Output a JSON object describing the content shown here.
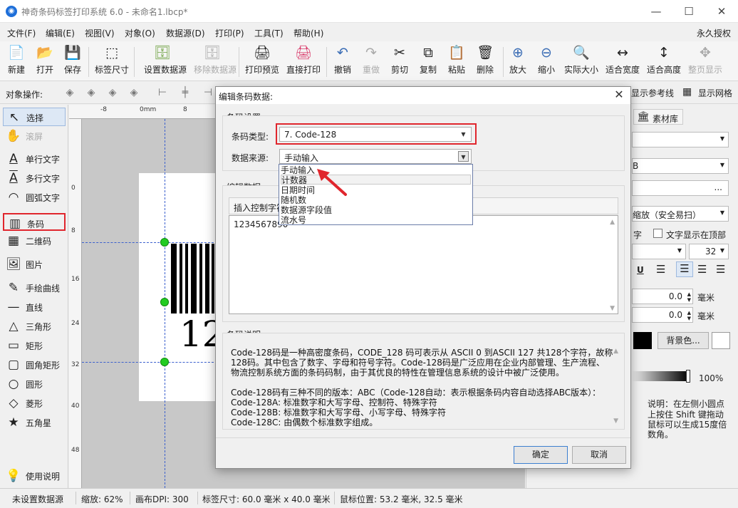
{
  "window": {
    "title": "神奇条码标签打印系统 6.0 - 未命名1.lbcp*",
    "minimize": "—",
    "maximize": "☐",
    "close": "✕"
  },
  "menu": [
    "文件(F)",
    "编辑(E)",
    "视图(V)",
    "对象(O)",
    "数据源(D)",
    "打印(P)",
    "工具(T)",
    "帮助(H)"
  ],
  "menu_right": "永久授权",
  "toolbar": [
    {
      "label": "新建",
      "icon": "📄"
    },
    {
      "label": "打开",
      "icon": "📂"
    },
    {
      "label": "保存",
      "icon": "💾"
    },
    {
      "label": "标签尺寸",
      "icon": "⬚"
    },
    {
      "label": "设置数据源",
      "icon": "🗄"
    },
    {
      "label": "移除数据源",
      "icon": "🗄"
    },
    {
      "label": "打印预览",
      "icon": "🖨"
    },
    {
      "label": "直接打印",
      "icon": "🖨"
    },
    {
      "label": "撤销",
      "icon": "↶"
    },
    {
      "label": "重做",
      "icon": "↷"
    },
    {
      "label": "剪切",
      "icon": "✂"
    },
    {
      "label": "复制",
      "icon": "⧉"
    },
    {
      "label": "粘贴",
      "icon": "📋"
    },
    {
      "label": "删除",
      "icon": "🗑"
    },
    {
      "label": "放大",
      "icon": "⊕"
    },
    {
      "label": "缩小",
      "icon": "⊖"
    },
    {
      "label": "实际大小",
      "icon": "🔍"
    },
    {
      "label": "适合宽度",
      "icon": "↔"
    },
    {
      "label": "适合高度",
      "icon": "↕"
    },
    {
      "label": "整页显示",
      "icon": "✥"
    }
  ],
  "objbar": {
    "label": "对象操作:",
    "show_guides": "显示参考线",
    "show_grid": "显示网格"
  },
  "tools": [
    {
      "label": "选择",
      "icon": "↖"
    },
    {
      "label": "滚屏",
      "icon": "✋"
    },
    {
      "label": "单行文字",
      "icon": "A"
    },
    {
      "label": "多行文字",
      "icon": "A"
    },
    {
      "label": "圆弧文字",
      "icon": "◠"
    },
    {
      "label": "条码",
      "icon": "▥"
    },
    {
      "label": "二维码",
      "icon": "▦"
    },
    {
      "label": "图片",
      "icon": "🖼"
    },
    {
      "label": "手绘曲线",
      "icon": "✎"
    },
    {
      "label": "直线",
      "icon": "—"
    },
    {
      "label": "三角形",
      "icon": "△"
    },
    {
      "label": "矩形",
      "icon": "▭"
    },
    {
      "label": "圆角矩形",
      "icon": "▢"
    },
    {
      "label": "圆形",
      "icon": "○"
    },
    {
      "label": "菱形",
      "icon": "◇"
    },
    {
      "label": "五角星",
      "icon": "★"
    },
    {
      "label": "使用说明",
      "icon": "💡"
    }
  ],
  "ruler": {
    "top": [
      "-8",
      "0mm",
      "8"
    ],
    "left": [
      "0",
      "8",
      "16",
      "24",
      "32",
      "40",
      "48"
    ]
  },
  "canvas": {
    "barcode_text": "12"
  },
  "right_panel": {
    "tab_material": "素材库",
    "field_b_partial": "B",
    "scale_option": "缩放（安全易扫）",
    "text_label_partial": "字",
    "text_top_label": "文字显示在顶部",
    "font_size": "32",
    "underline": "U",
    "x_value": "0.0",
    "y_value": "0.0",
    "unit_mm_1": "毫米",
    "unit_mm_2": "毫米",
    "bg_button": "背景色...",
    "opacity": "100%",
    "hint": [
      "说明：在左侧小圆点",
      "上按住 Shift 键拖动",
      "鼠标可以生成15度倍",
      "数角。"
    ],
    "colors": {
      "fg": "#000000",
      "bg": "#ffffff"
    }
  },
  "dialog": {
    "title": "编辑条码数据:",
    "close": "✕",
    "barcode_settings": "条码设置",
    "type_label": "条码类型:",
    "type_value": "7.  Code-128",
    "source_label": "数据来源:",
    "source_value": "手动输入",
    "source_options": [
      "手动输入",
      "计数器",
      "日期时间",
      "随机数",
      "数据源字段值",
      "流水号"
    ],
    "edit_data": "编辑数据",
    "insert_ctrl": "插入控制字符",
    "data_value": "1234567890",
    "desc_title": "条码说明",
    "desc_lines": [
      "Code-128码是一种高密度条码，CODE_128 码可表示从 ASCII 0 到ASCII 127 共128个字符，故称",
      "128码。其中包含了数字、字母和符号字符。Code-128码是广泛应用在企业内部管理、生产流程、",
      "物流控制系统方面的条码码制，由于其优良的特性在管理信息系统的设计中被广泛使用。",
      "",
      "Code-128码有三种不同的版本：ABC（Code-128自动：表示根据条码内容自动选择ABC版本）：",
      "Code-128A: 标准数字和大写字母、控制符、特殊字符",
      "Code-128B: 标准数字和大写字母、小写字母、特殊字符",
      "Code-128C: 由偶数个标准数字组成。"
    ],
    "ok": "确定",
    "cancel": "取消"
  },
  "statusbar": {
    "datasource": "未设置数据源",
    "zoom": "缩放: 62%",
    "dpi": "画布DPI: 300",
    "label_size": "标签尺寸: 60.0 毫米 x 40.0 毫米",
    "mouse_pos": "鼠标位置: 53.2 毫米, 32.5 毫米"
  },
  "accent": {
    "highlight_red": "#e0262d",
    "handle_green": "#22cc22",
    "guide_blue": "#3a5fcd"
  }
}
